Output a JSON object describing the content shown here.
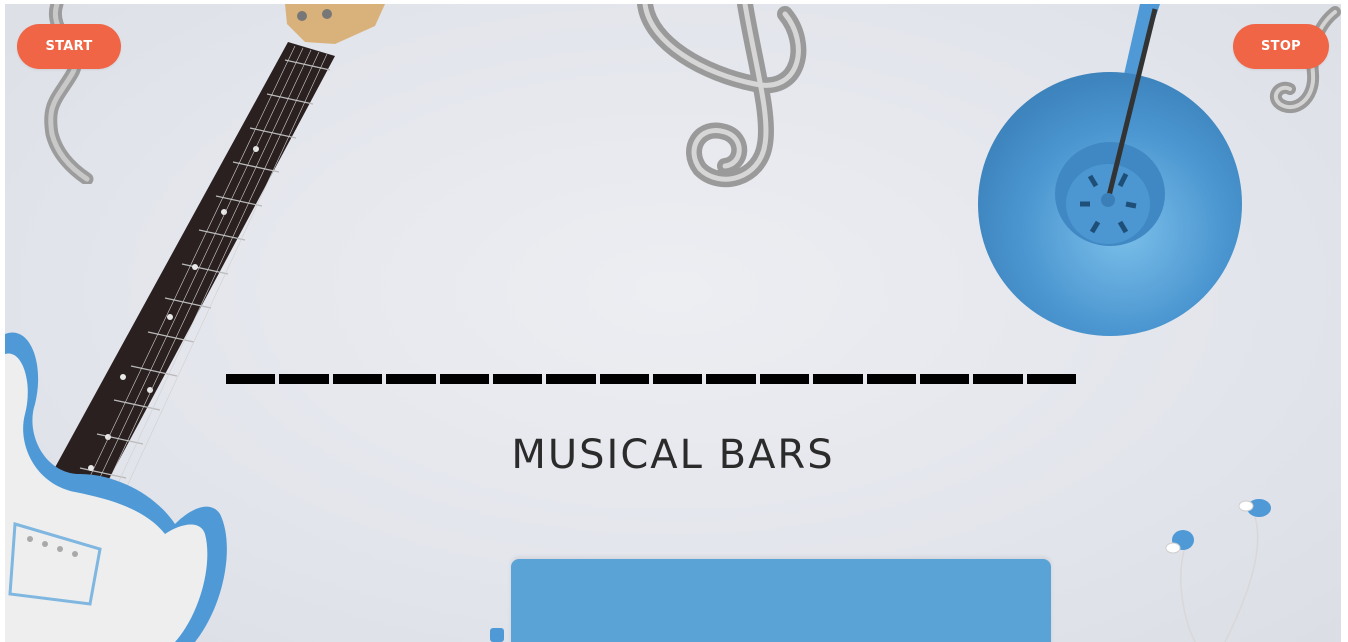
{
  "controls": {
    "start_label": "START",
    "stop_label": "STOP"
  },
  "visualizer": {
    "bar_count": 16
  },
  "heading": {
    "title": "MUSICAL BARS"
  },
  "colors": {
    "button": "#ef6545",
    "bar": "#000000",
    "background": "#e3e5ec",
    "accent_blue": "#4f9ad6",
    "chrome": "#a6a6a6"
  },
  "decorations": [
    "electric-guitar",
    "treble-clef",
    "bass-clef-fragment",
    "blue-lamp",
    "earphones",
    "blue-keyboard-case"
  ]
}
